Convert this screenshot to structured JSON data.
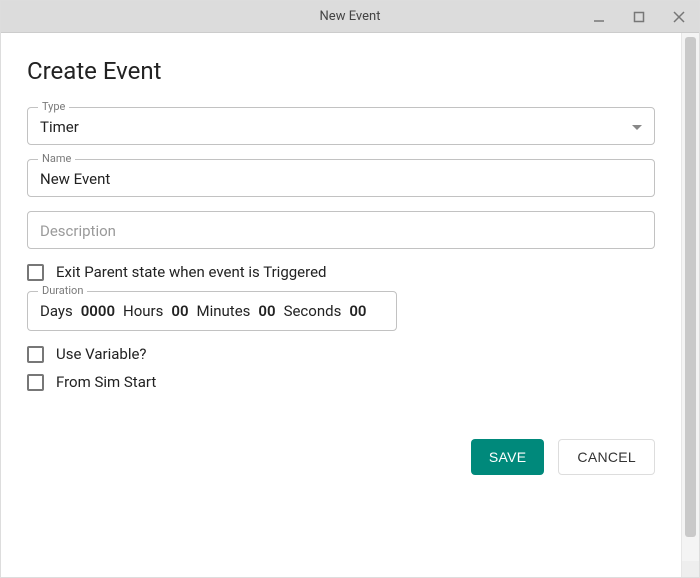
{
  "window": {
    "title": "New Event"
  },
  "page": {
    "heading": "Create Event"
  },
  "fields": {
    "type": {
      "label": "Type",
      "value": "Timer"
    },
    "name": {
      "label": "Name",
      "value": "New Event"
    },
    "description": {
      "placeholder": "Description"
    },
    "duration": {
      "label": "Duration",
      "days": {
        "label": "Days",
        "value": "0000"
      },
      "hours": {
        "label": "Hours",
        "value": "00"
      },
      "minutes": {
        "label": "Minutes",
        "value": "00"
      },
      "seconds": {
        "label": "Seconds",
        "value": "00"
      }
    }
  },
  "checkboxes": {
    "exit_parent": {
      "label": "Exit Parent state when event is Triggered",
      "checked": false
    },
    "use_variable": {
      "label": "Use Variable?",
      "checked": false
    },
    "from_sim": {
      "label": "From Sim Start",
      "checked": false
    }
  },
  "buttons": {
    "save": "SAVE",
    "cancel": "CANCEL"
  }
}
